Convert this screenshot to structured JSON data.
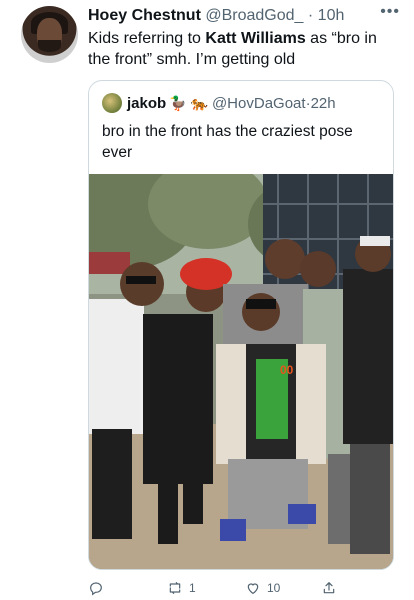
{
  "author": {
    "name": "Hoey Chestnut",
    "handle": "@BroadGod_",
    "separator": "·",
    "time": "10h",
    "more_icon": "more-icon"
  },
  "tweet": {
    "text_before": "Kids referring to ",
    "text_bold": "Katt Williams",
    "text_after": " as “bro in the front” smh. I’m getting old"
  },
  "quoted": {
    "name": "jakob",
    "emoji": "🦆 🐅",
    "handle": "@HovDaGoat",
    "separator": "·",
    "time": "22h",
    "text": "bro in the front has the craziest pose ever"
  },
  "actions": {
    "reply_icon": "reply-icon",
    "retweet_icon": "retweet-icon",
    "retweet_count": "1",
    "like_icon": "like-icon",
    "like_count": "10",
    "share_icon": "share-icon"
  },
  "colors": {
    "text": "#0f1419",
    "secondary": "#536471",
    "border": "#cfd9de"
  }
}
